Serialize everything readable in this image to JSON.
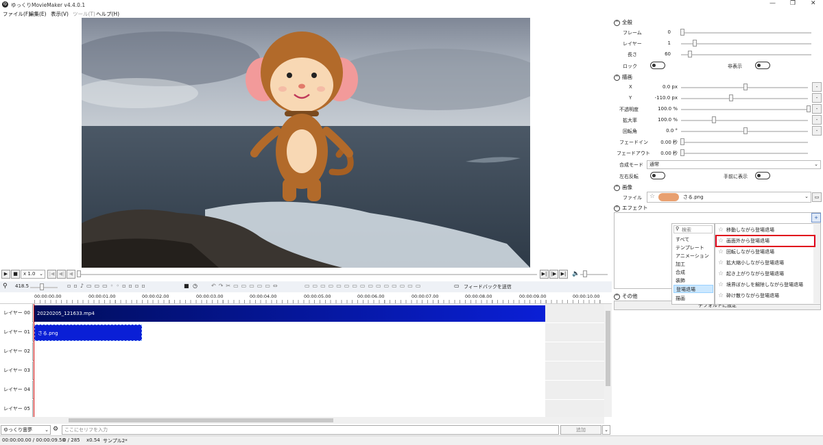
{
  "window": {
    "title": "ゆっくりMovieMaker v4.4.0.1",
    "controls": [
      "—",
      "❐",
      "✕"
    ]
  },
  "menu": [
    {
      "label": "ファイル(F)",
      "enabled": true
    },
    {
      "label": "編集(E)",
      "enabled": true
    },
    {
      "label": "表示(V)",
      "enabled": true
    },
    {
      "label": "ツール(T)",
      "enabled": false
    },
    {
      "label": "ヘルプ(H)",
      "enabled": true
    }
  ],
  "properties": {
    "general": {
      "header": "全般",
      "frame_label": "フレーム",
      "frame_value": "0",
      "layer_label": "レイヤー",
      "layer_value": "1",
      "length_label": "長さ",
      "length_value": "60",
      "lock_label": "ロック",
      "hidden_label": "非表示"
    },
    "drawing": {
      "header": "描画",
      "x_label": "X",
      "x_value": "0.0 px",
      "y_label": "Y",
      "y_value": "-110.0 px",
      "opacity_label": "不透明度",
      "opacity_value": "100.0 %",
      "zoom_label": "拡大率",
      "zoom_value": "100.0 %",
      "rotation_label": "回転角",
      "rotation_value": "0.0 °",
      "fadein_label": "フェードイン",
      "fadein_value": "0.00 秒",
      "fadeout_label": "フェードアウト",
      "fadeout_value": "0.00 秒",
      "blend_label": "合成モード",
      "blend_value": "通常",
      "flip_label": "左右反転",
      "front_label": "手前に表示"
    },
    "image": {
      "header": "画像",
      "file_label": "ファイル",
      "file_value": "さる.png"
    },
    "effects": {
      "header": "エフェクト",
      "search_placeholder": "検索",
      "categories": [
        "すべて",
        "テンプレート",
        "アニメーション",
        "加工",
        "合成",
        "装飾",
        "登場退場",
        "描画"
      ],
      "selected_category": "登場退場",
      "items": [
        "移動しながら登場退場",
        "画面外から登場退場",
        "回転しながら登場退場",
        "拡大縮小しながら登場退場",
        "起き上がりながら登場退場",
        "境界ぼかしを解除しながら登場退場",
        "砕け散りながら登場退場"
      ],
      "highlighted_item": "画面外から登場退場"
    },
    "other": {
      "header": "その他",
      "reset_button": "デフォルトに設定"
    }
  },
  "transport": {
    "speed": "x 1.0"
  },
  "toolbar": {
    "zoom_value": "418.5",
    "feedback_label": "フィードバックを送信"
  },
  "ruler": {
    "ticks": [
      "00:00:00.00",
      "00:00:01.00",
      "00:00:02.00",
      "00:00:03.00",
      "00:00:04.00",
      "00:00:05.00",
      "00:00:06.00",
      "00:00:07.00",
      "00:00:08.00",
      "00:00:09.00",
      "00:00:10.00"
    ]
  },
  "layers": [
    {
      "name": "レイヤー 00",
      "clip": "20220205_121633.mp4"
    },
    {
      "name": "レイヤー 01",
      "clip": "さる.png"
    },
    {
      "name": "レイヤー 02",
      "clip": ""
    },
    {
      "name": "レイヤー 03",
      "clip": ""
    },
    {
      "name": "レイヤー 04",
      "clip": ""
    },
    {
      "name": "レイヤー 05",
      "clip": ""
    }
  ],
  "bottombar": {
    "character": "ゆっくり霊夢",
    "serif_placeholder": "ここにセリフを入力",
    "add_button": "追加"
  },
  "status": {
    "time": "00:00:00.00 / 00:00:09.50",
    "frames": "0 / 285",
    "zoom": "x0.54",
    "project": "サンプル2*"
  },
  "colors": {
    "video_clip": "#00168a",
    "image_clip": "#0a1fd6",
    "highlight_box": "#e0001a",
    "selected_category": "#cce8ff"
  }
}
